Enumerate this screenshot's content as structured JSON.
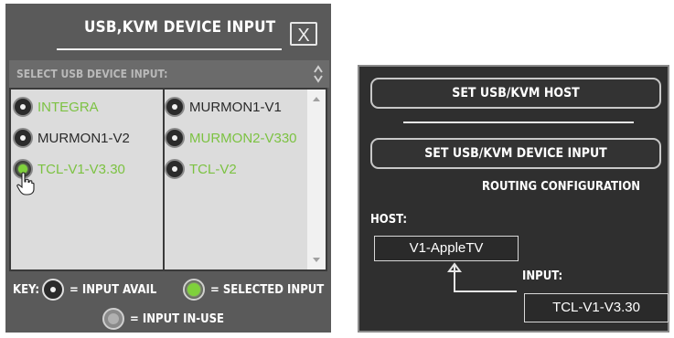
{
  "left_panel": {
    "title": "USB,KVM DEVICE INPUT",
    "close_label": "X",
    "select_label": "SELECT USB DEVICE INPUT:",
    "column1": [
      {
        "label": "INTEGRA",
        "state": "in-use"
      },
      {
        "label": "MURMON1-V2",
        "state": "available"
      },
      {
        "label": "TCL-V1-V3.30",
        "state": "selected"
      }
    ],
    "column2": [
      {
        "label": "MURMON1-V1",
        "state": "available"
      },
      {
        "label": "MURMON2-V330",
        "state": "in-use"
      },
      {
        "label": "TCL-V2",
        "state": "in-use"
      }
    ],
    "key": {
      "prefix": "KEY:",
      "avail": "= INPUT AVAIL",
      "selected": "= SELECTED INPUT",
      "inuse": "= INPUT IN-USE"
    }
  },
  "right_panel": {
    "set_host_label": "SET USB/KVM HOST",
    "set_device_label": "SET USB/KVM DEVICE INPUT",
    "routing_label": "ROUTING CONFIGURATION",
    "host_label": "HOST:",
    "host_value": "V1-AppleTV",
    "input_label": "INPUT:",
    "input_value": "TCL-V1-V3.30"
  },
  "colors": {
    "panel_bg": "#5a5a5a",
    "right_bg": "#2f2f2f",
    "green_text": "#7cc242",
    "selected_radio": "#7fd13b"
  }
}
